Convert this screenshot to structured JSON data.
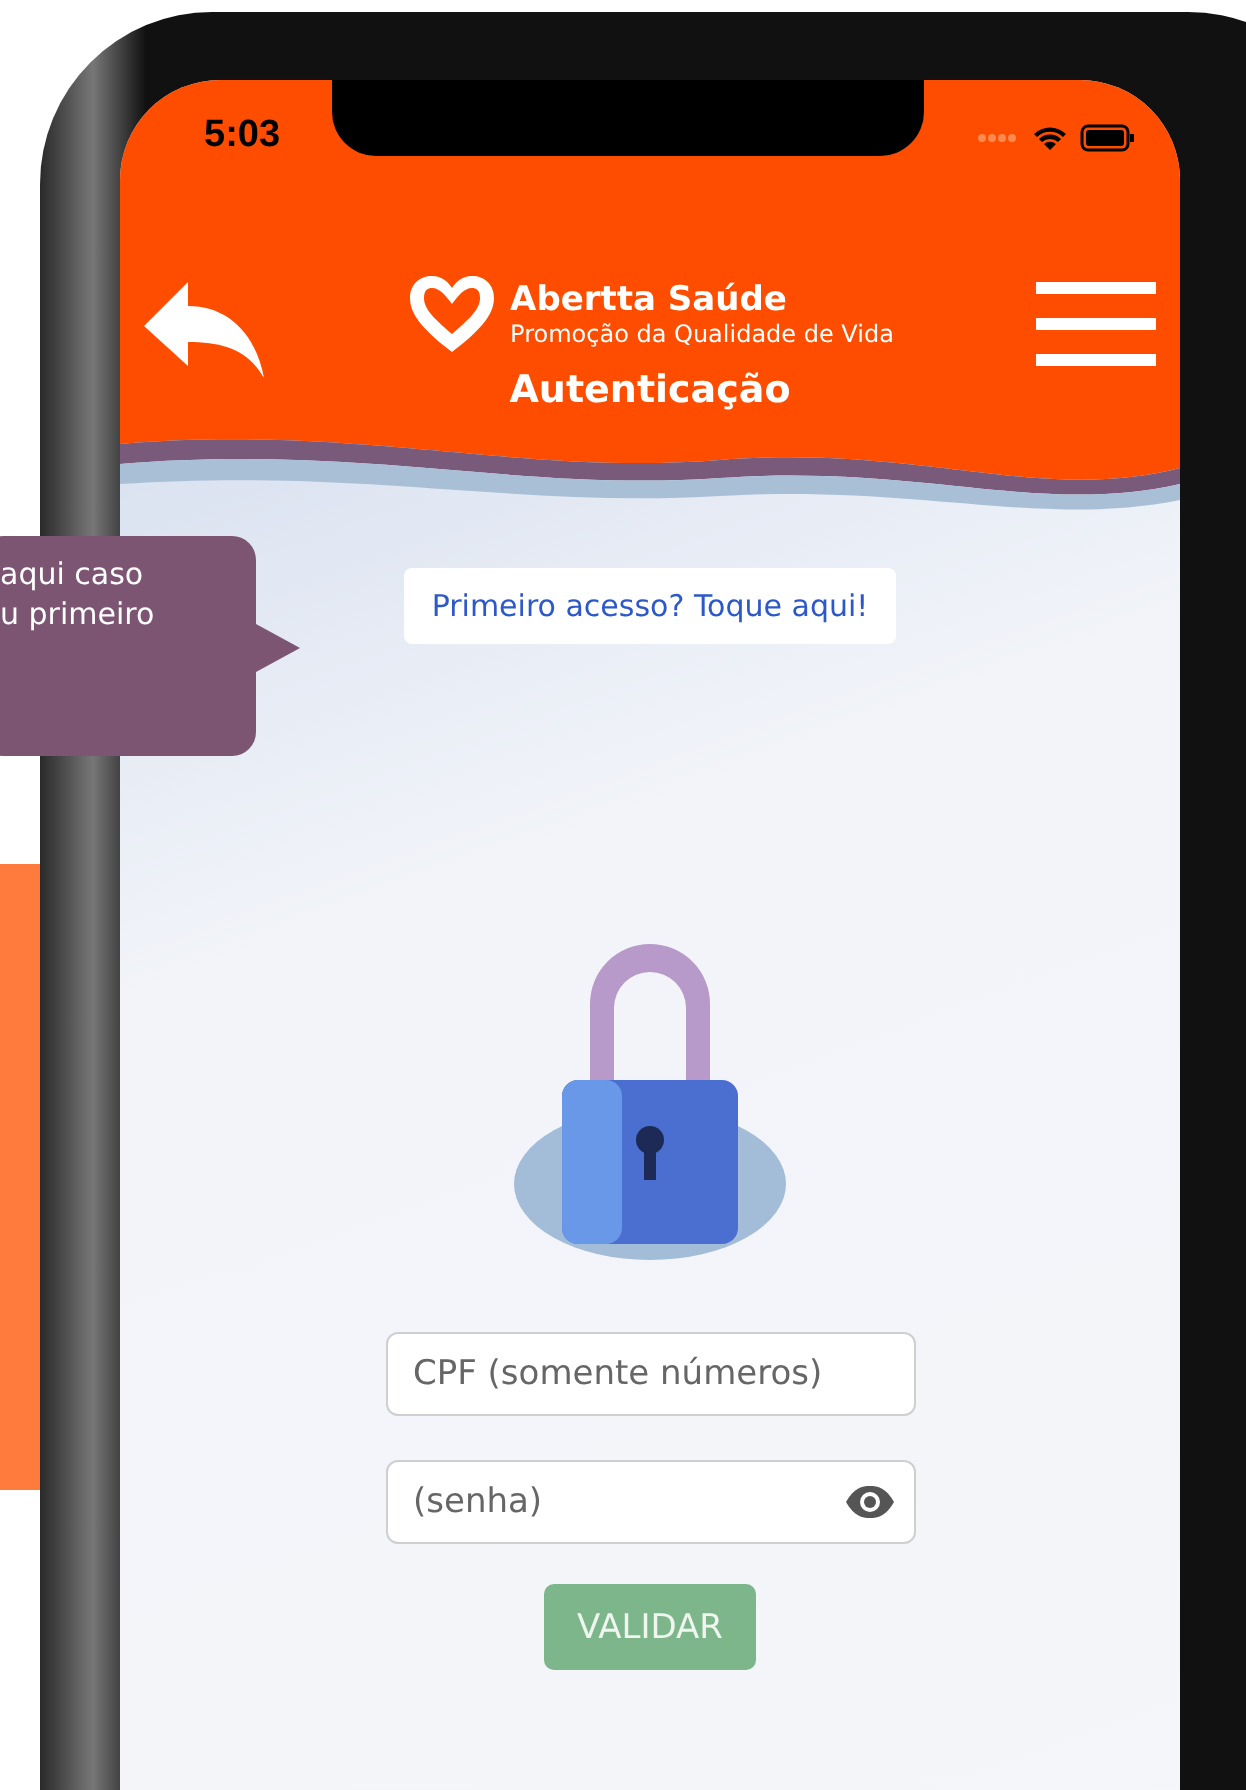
{
  "tooltip": {
    "lines": [
      "aqui caso",
      "u primeiro"
    ]
  },
  "status_bar": {
    "time": "5:03"
  },
  "header": {
    "app_name": "Abertta Saúde",
    "tagline": "Promoção da Qualidade de Vida",
    "title": "Autenticação"
  },
  "first_access_link": "Primeiro acesso? Toque aqui!",
  "cpf_field": {
    "placeholder": "CPF (somente números)"
  },
  "password_field": {
    "placeholder": "(senha)"
  },
  "validate_button": {
    "label": "VALIDAR",
    "disabled": true
  }
}
